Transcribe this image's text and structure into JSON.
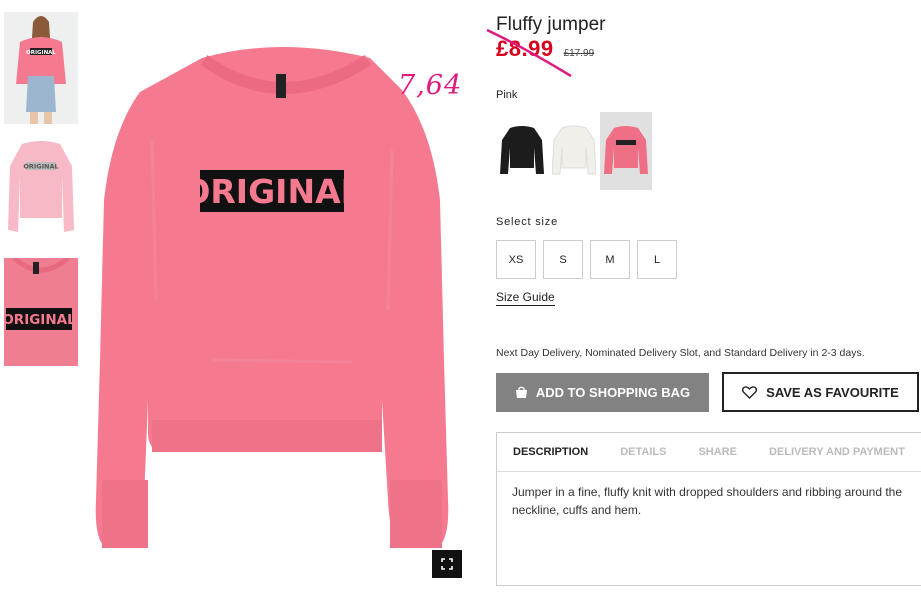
{
  "product": {
    "title": "Fluffy jumper",
    "price_current": "£8.99",
    "price_old": "£17.99",
    "annotation_price": "7,64",
    "color_label": "Pink",
    "swatches": [
      {
        "name": "black",
        "color": "#1c1c1c"
      },
      {
        "name": "white",
        "color": "#f1efe9"
      },
      {
        "name": "pink",
        "color": "#ef6f86",
        "selected": true
      }
    ],
    "size_label": "Select size",
    "sizes": [
      "XS",
      "S",
      "M",
      "L"
    ],
    "size_guide": "Size Guide",
    "delivery_text": "Next Day Delivery, Nominated Delivery Slot, and Standard Delivery in 2-3 days.",
    "add_to_bag_label": "ADD TO SHOPPING BAG",
    "save_favourite_label": "SAVE AS FAVOURITE",
    "print_text": "ORIGINAL"
  },
  "tabs": [
    {
      "label": "DESCRIPTION",
      "active": true
    },
    {
      "label": "DETAILS"
    },
    {
      "label": "SHARE"
    },
    {
      "label": "DELIVERY AND PAYMENT"
    }
  ],
  "description": "Jumper in a fine, fluffy knit with dropped shoulders and ribbing around the neckline, cuffs and hem.",
  "colors": {
    "sweater": "#f57a90",
    "sale_red": "#d6001c",
    "annotation": "#e0197d",
    "bag_button": "#828282"
  }
}
